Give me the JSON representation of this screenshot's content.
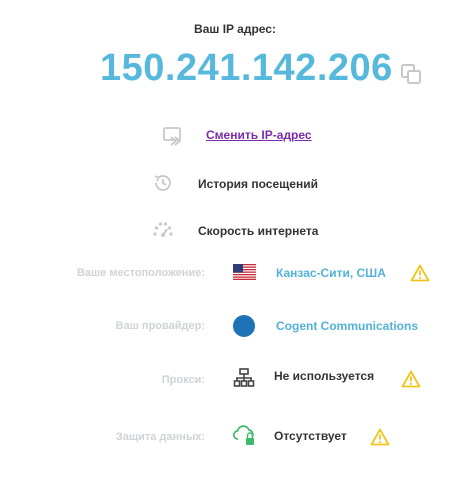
{
  "header": {
    "title": "Ваш IP адрес:",
    "ip": "150.241.142.206"
  },
  "actions": {
    "change_ip": "Сменить IP-адрес",
    "history": "История посещений",
    "speed": "Скорость интернета"
  },
  "info": {
    "location": {
      "label": "Ваше местоположение:",
      "value": "Канзас-Сити, США"
    },
    "provider": {
      "label": "Ваш провайдер:",
      "value": "Cogent Communications"
    },
    "proxy": {
      "label": "Прокси:",
      "value": "Не используется"
    },
    "protection": {
      "label": "Защита данных:",
      "value": "Отсутствует"
    }
  },
  "colors": {
    "accent": "#56b8dc",
    "link": "#7b2ca8",
    "warning": "#f0c419",
    "label": "#cfd3d6"
  }
}
